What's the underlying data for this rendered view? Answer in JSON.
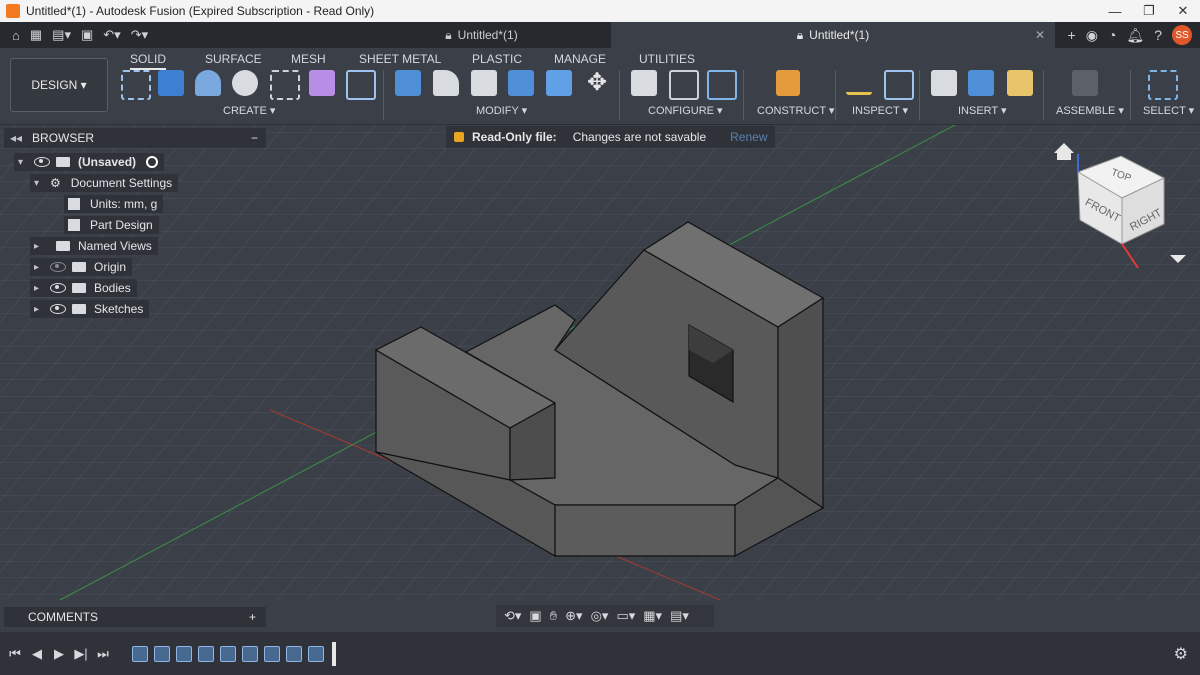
{
  "window": {
    "title": "Untitled*(1) - Autodesk Fusion (Expired Subscription - Read Only)"
  },
  "tabs": {
    "tab1": "Untitled*(1)",
    "tab2": "Untitled*(1)",
    "avatar": "SS"
  },
  "workspace": {
    "label": "DESIGN ▾"
  },
  "ribbon_tabs": [
    "SOLID",
    "SURFACE",
    "MESH",
    "SHEET METAL",
    "PLASTIC",
    "MANAGE",
    "UTILITIES"
  ],
  "ribbon_groups": [
    "CREATE ▾",
    "MODIFY ▾",
    "CONFIGURE ▾",
    "CONSTRUCT ▾",
    "INSPECT ▾",
    "INSERT ▾",
    "ASSEMBLE ▾",
    "SELECT ▾"
  ],
  "browser": {
    "title": "BROWSER",
    "root": "(Unsaved)",
    "doc_settings": "Document Settings",
    "units": "Units: mm, g",
    "part_design": "Part Design",
    "named_views": "Named Views",
    "origin": "Origin",
    "bodies": "Bodies",
    "sketches": "Sketches"
  },
  "readonly": {
    "label": "Read-Only file:",
    "message": "Changes are not savable",
    "link": "Renew"
  },
  "viewcube": {
    "top": "TOP",
    "front": "FRONT",
    "right": "RIGHT"
  },
  "comments": {
    "label": "COMMENTS"
  },
  "colors": {
    "background": "#3b4048",
    "panel": "#2f3339",
    "accent": "#e0582a",
    "model": "#6a6a6a"
  }
}
